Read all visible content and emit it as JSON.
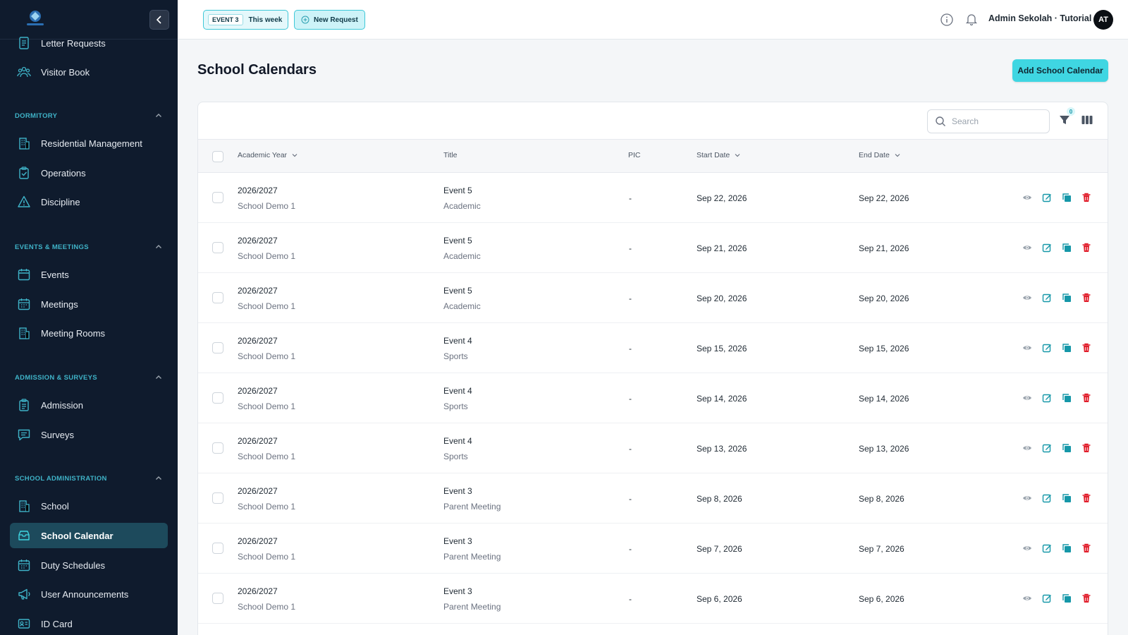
{
  "sidebar": {
    "items_top": [
      {
        "label": "Letter Requests",
        "icon": "letter-icon"
      },
      {
        "label": "Visitor Book",
        "icon": "visitors-icon"
      }
    ],
    "sections": [
      {
        "title": "DORMITORY",
        "items": [
          {
            "label": "Residential Management",
            "icon": "building-icon"
          },
          {
            "label": "Operations",
            "icon": "clipboard-check-icon"
          },
          {
            "label": "Discipline",
            "icon": "warning-icon"
          }
        ]
      },
      {
        "title": "EVENTS & MEETINGS",
        "items": [
          {
            "label": "Events",
            "icon": "calendar-icon"
          },
          {
            "label": "Meetings",
            "icon": "calendar-grid-icon"
          },
          {
            "label": "Meeting Rooms",
            "icon": "building-icon"
          }
        ]
      },
      {
        "title": "ADMISSION & SURVEYS",
        "items": [
          {
            "label": "Admission",
            "icon": "clipboard-icon"
          },
          {
            "label": "Surveys",
            "icon": "chat-icon"
          }
        ]
      },
      {
        "title": "SCHOOL ADMINISTRATION",
        "items": [
          {
            "label": "School",
            "icon": "building-icon"
          },
          {
            "label": "School Calendar",
            "icon": "calendar-tray-icon",
            "active": true
          },
          {
            "label": "Duty Schedules",
            "icon": "calendar-grid-icon"
          },
          {
            "label": "User Announcements",
            "icon": "megaphone-icon"
          },
          {
            "label": "ID Card",
            "icon": "id-card-icon"
          }
        ]
      }
    ]
  },
  "header": {
    "event_tag": "EVENT 3",
    "event_label": "This week",
    "new_request": "New Request",
    "user": "Admin Sekolah · Tutorial",
    "avatar": "AT"
  },
  "page": {
    "title": "School Calendars",
    "add_button": "Add School Calendar",
    "search_placeholder": "Search",
    "filter_count": "0"
  },
  "table": {
    "columns": [
      "Academic Year",
      "Title",
      "PIC",
      "Start Date",
      "End Date"
    ],
    "rows": [
      {
        "year": "2026/2027",
        "school": "School Demo 1",
        "title": "Event 5",
        "category": "Academic",
        "pic": "-",
        "start": "Sep 22, 2026",
        "end": "Sep 22, 2026"
      },
      {
        "year": "2026/2027",
        "school": "School Demo 1",
        "title": "Event 5",
        "category": "Academic",
        "pic": "-",
        "start": "Sep 21, 2026",
        "end": "Sep 21, 2026"
      },
      {
        "year": "2026/2027",
        "school": "School Demo 1",
        "title": "Event 5",
        "category": "Academic",
        "pic": "-",
        "start": "Sep 20, 2026",
        "end": "Sep 20, 2026"
      },
      {
        "year": "2026/2027",
        "school": "School Demo 1",
        "title": "Event 4",
        "category": "Sports",
        "pic": "-",
        "start": "Sep 15, 2026",
        "end": "Sep 15, 2026"
      },
      {
        "year": "2026/2027",
        "school": "School Demo 1",
        "title": "Event 4",
        "category": "Sports",
        "pic": "-",
        "start": "Sep 14, 2026",
        "end": "Sep 14, 2026"
      },
      {
        "year": "2026/2027",
        "school": "School Demo 1",
        "title": "Event 4",
        "category": "Sports",
        "pic": "-",
        "start": "Sep 13, 2026",
        "end": "Sep 13, 2026"
      },
      {
        "year": "2026/2027",
        "school": "School Demo 1",
        "title": "Event 3",
        "category": "Parent Meeting",
        "pic": "-",
        "start": "Sep 8, 2026",
        "end": "Sep 8, 2026"
      },
      {
        "year": "2026/2027",
        "school": "School Demo 1",
        "title": "Event 3",
        "category": "Parent Meeting",
        "pic": "-",
        "start": "Sep 7, 2026",
        "end": "Sep 7, 2026"
      },
      {
        "year": "2026/2027",
        "school": "School Demo 1",
        "title": "Event 3",
        "category": "Parent Meeting",
        "pic": "-",
        "start": "Sep 6, 2026",
        "end": "Sep 6, 2026"
      }
    ]
  },
  "colors": {
    "sidebar_bg": "#0f1b2d",
    "accent": "#3fd6e2",
    "section_title": "#3fb3c8",
    "action_icons": "#1597a8",
    "delete_icon": "#e11d2a"
  }
}
